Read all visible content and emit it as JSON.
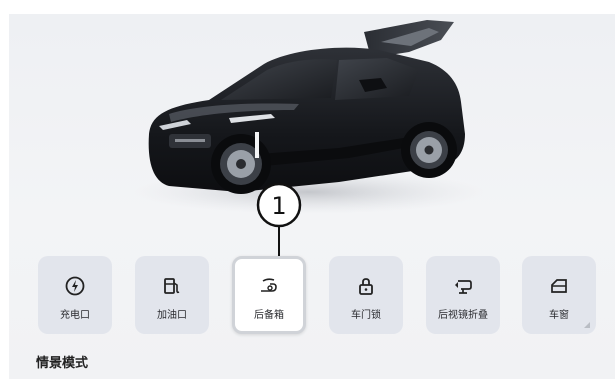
{
  "callout": {
    "number": "1"
  },
  "controls": [
    {
      "label": "充电口",
      "icon": "charge-port-icon",
      "active": false
    },
    {
      "label": "加油口",
      "icon": "fuel-cap-icon",
      "active": false
    },
    {
      "label": "后备箱",
      "icon": "trunk-icon",
      "active": true
    },
    {
      "label": "车门锁",
      "icon": "lock-icon",
      "active": false
    },
    {
      "label": "后视镜折叠",
      "icon": "mirror-fold-icon",
      "active": false
    },
    {
      "label": "车窗",
      "icon": "window-icon",
      "active": false
    }
  ],
  "section": {
    "title": "情景模式"
  },
  "colors": {
    "tile_bg": "#e2e5ec",
    "tile_active_bg": "#ffffff",
    "car_body": "#16181c"
  }
}
